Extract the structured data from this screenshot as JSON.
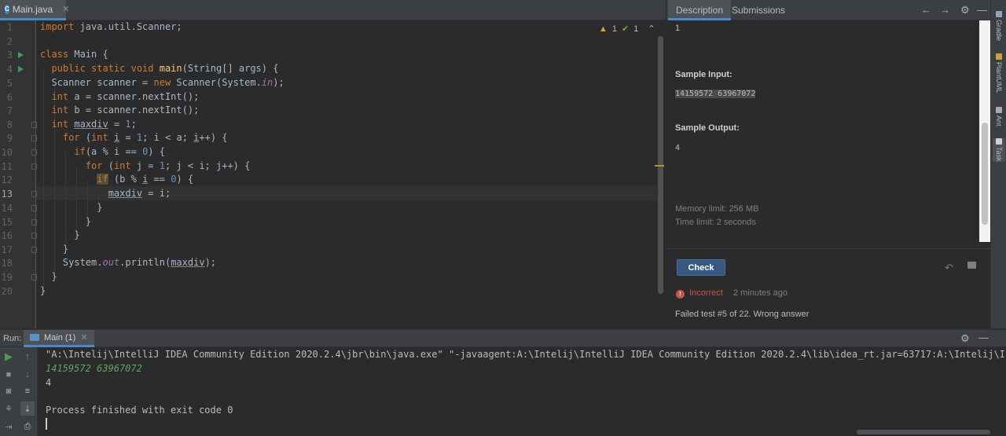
{
  "editor": {
    "tab_label": "Main.java",
    "file_icon": "c-class-icon",
    "inspection": {
      "warnings": "1",
      "ok": "1"
    },
    "line_numbers": [
      "1",
      "2",
      "3",
      "4",
      "5",
      "6",
      "7",
      "8",
      "9",
      "10",
      "11",
      "12",
      "13",
      "14",
      "15",
      "16",
      "17",
      "18",
      "19",
      "20"
    ],
    "current_line": 13
  },
  "right_panel": {
    "tabs": [
      "Description",
      "Submissions"
    ],
    "active_tab": "Description",
    "top_text": "1",
    "sample_input_label": "Sample Input:",
    "sample_input": "14159572 63967072",
    "sample_output_label": "Sample Output:",
    "sample_output": "4",
    "memory_limit": "Memory limit: 256 MB",
    "time_limit": "Time limit: 2 seconds",
    "check_button": "Check",
    "status": "Incorrect",
    "status_time": "2 minutes ago",
    "result_message": "Failed test #5 of 22. Wrong answer"
  },
  "tool_strip": [
    "Gradle",
    "PlantUML",
    "Ant",
    "Task"
  ],
  "run": {
    "label": "Run:",
    "tab_label": "Main (1)",
    "console_lines": [
      "\"A:\\Intelij\\IntelliJ IDEA Community Edition 2020.2.4\\jbr\\bin\\java.exe\" \"-javaagent:A:\\Intelij\\IntelliJ IDEA Community Edition 2020.2.4\\lib\\idea_rt.jar=63717:A:\\Intelij\\IntelliJ I",
      "14159572 63967072",
      "4",
      "",
      "Process finished with exit code 0"
    ]
  },
  "colors": {
    "accent": "#4a88c7",
    "keyword": "#cc7832",
    "error": "#c75450",
    "run_green": "#499c54"
  }
}
